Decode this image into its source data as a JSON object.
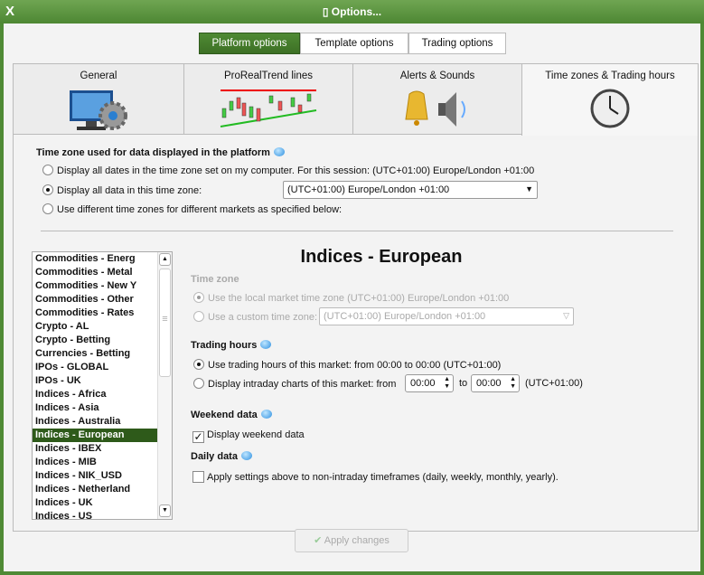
{
  "window": {
    "title": "Options...",
    "close": "X"
  },
  "top_tabs": [
    "Platform options",
    "Template options",
    "Trading options"
  ],
  "sub_tabs": [
    "General",
    "ProRealTrend lines",
    "Alerts & Sounds",
    "Time zones & Trading hours"
  ],
  "timezone": {
    "heading": "Time zone used for data displayed in the platform",
    "opt1": "Display all dates in the time zone set on my computer. For this session:  (UTC+01:00) Europe/London +01:00",
    "opt2": "Display all data in this time zone:",
    "opt2_value": "(UTC+01:00) Europe/London +01:00",
    "opt3": "Use different time zones for different markets as specified below:"
  },
  "markets": [
    "Commodities - Energ",
    "Commodities - Metal",
    "Commodities - New Y",
    "Commodities - Other",
    "Commodities - Rates",
    "Crypto - AL",
    "Crypto - Betting",
    "Currencies - Betting",
    "IPOs - GLOBAL",
    "IPOs - UK",
    "Indices - Africa",
    "Indices - Asia",
    "Indices - Australia",
    "Indices - European",
    "Indices - IBEX",
    "Indices - MIB",
    "Indices - NIK_USD",
    "Indices - Netherland",
    "Indices - UK",
    "Indices - US"
  ],
  "selected_market": "Indices - European",
  "detail": {
    "title": "Indices - European",
    "tz_heading": "Time zone",
    "tz_local": "Use the local market time zone (UTC+01:00) Europe/London +01:00",
    "tz_custom": "Use a custom time zone:",
    "tz_custom_value": "(UTC+01:00) Europe/London +01:00",
    "th_heading": "Trading hours",
    "th_opt1": "Use trading hours of this market: from 00:00 to 00:00  (UTC+01:00)",
    "th_opt2": "Display intraday charts of this market:  from",
    "from": "00:00",
    "to_label": "to",
    "to": "00:00",
    "utc": "(UTC+01:00)",
    "we_heading": "Weekend data",
    "we_label": "Display weekend data",
    "we_checked": true,
    "dd_heading": "Daily data",
    "dd_label": "Apply settings above to non-intraday timeframes (daily, weekly, monthly, yearly).",
    "dd_checked": false
  },
  "apply": "Apply changes",
  "colors": {
    "accent": "#4f8a34",
    "selected": "#2e5a1a"
  }
}
